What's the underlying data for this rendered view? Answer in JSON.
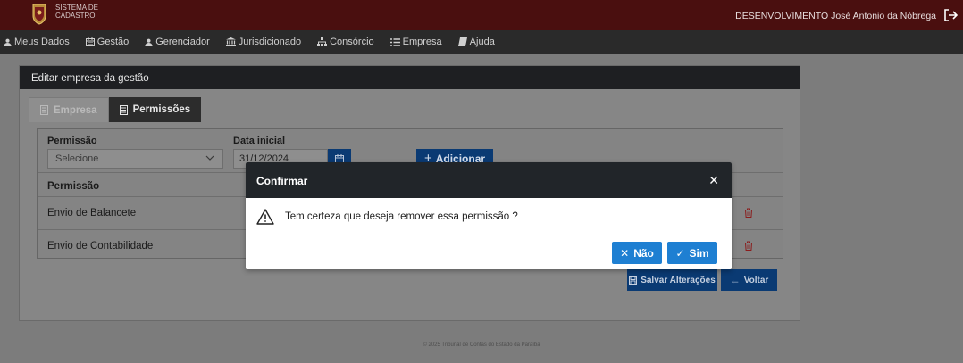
{
  "header": {
    "brand_line1": "Sistema de",
    "brand_line2": "Cadastro",
    "user": "DESENVOLVIMENTO José Antonio da Nóbrega"
  },
  "nav": [
    {
      "label": "Meus Dados",
      "icon": "user-icon"
    },
    {
      "label": "Gestão",
      "icon": "calendar-icon"
    },
    {
      "label": "Gerenciador",
      "icon": "user-icon"
    },
    {
      "label": "Jurisdicionado",
      "icon": "institution-icon"
    },
    {
      "label": "Consórcio",
      "icon": "sitemap-icon"
    },
    {
      "label": "Empresa",
      "icon": "list-icon"
    },
    {
      "label": "Ajuda",
      "icon": "book-icon"
    }
  ],
  "card": {
    "title": "Editar empresa da gestão",
    "tabs": [
      {
        "label": "Empresa",
        "active": false
      },
      {
        "label": "Permissões",
        "active": true
      }
    ]
  },
  "form": {
    "permissao_label": "Permissão",
    "permissao_value": "Selecione",
    "data_label": "Data inicial",
    "data_value": "31/12/2024",
    "add_label": "Adicionar"
  },
  "table": {
    "header": "Permissão",
    "rows": [
      "Envio de Balancete",
      "Envio de Contabilidade"
    ]
  },
  "actions": {
    "save": "Salvar Alterações",
    "back": "Voltar"
  },
  "footer": "© 2025 Tribunal de Contas do Estado da Paraíba",
  "modal": {
    "title": "Confirmar",
    "message": "Tem certeza que deseja remover essa permissão ?",
    "no_label": "Não",
    "yes_label": "Sim"
  },
  "colors": {
    "topbar": "#4a0f0f",
    "navbar": "#2a2a2a",
    "primary": "#0a3a73",
    "modal_button": "#1e7fd2"
  }
}
